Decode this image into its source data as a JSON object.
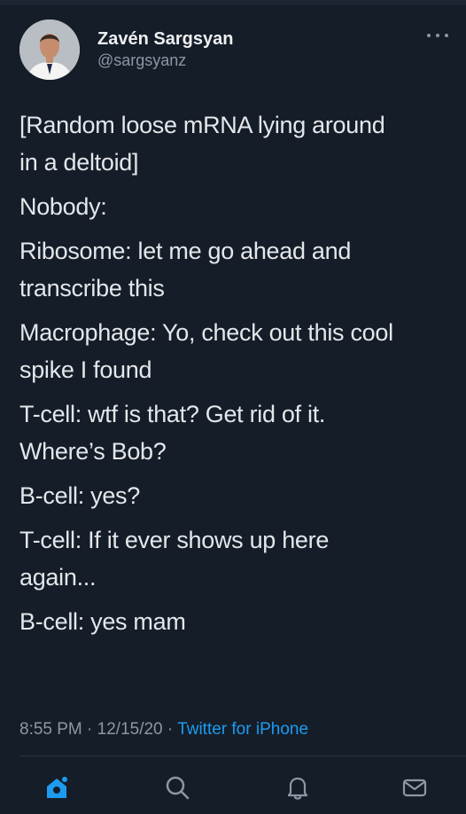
{
  "author": {
    "name": "Zavén Sargsyan",
    "handle": "@sargsyanz"
  },
  "tweet": {
    "paragraphs": [
      "[Random loose mRNA lying around\nin a deltoid]",
      "Nobody:",
      "Ribosome: let me go ahead and\ntranscribe this",
      "Macrophage: Yo, check out this cool\nspike I found",
      "T-cell: wtf is that? Get rid of it.\nWhere’s Bob?",
      "B-cell: yes?",
      "T-cell: If it ever shows up here\nagain...",
      "B-cell: yes mam"
    ],
    "time": "8:55 PM",
    "date": "12/15/20",
    "source": "Twitter for iPhone"
  },
  "nav": {
    "items": [
      "home-icon",
      "search-icon",
      "notifications-icon",
      "messages-icon"
    ]
  },
  "colors": {
    "background": "#151d28",
    "accent": "#1d9bf0",
    "secondary_text": "#8b98a5"
  }
}
